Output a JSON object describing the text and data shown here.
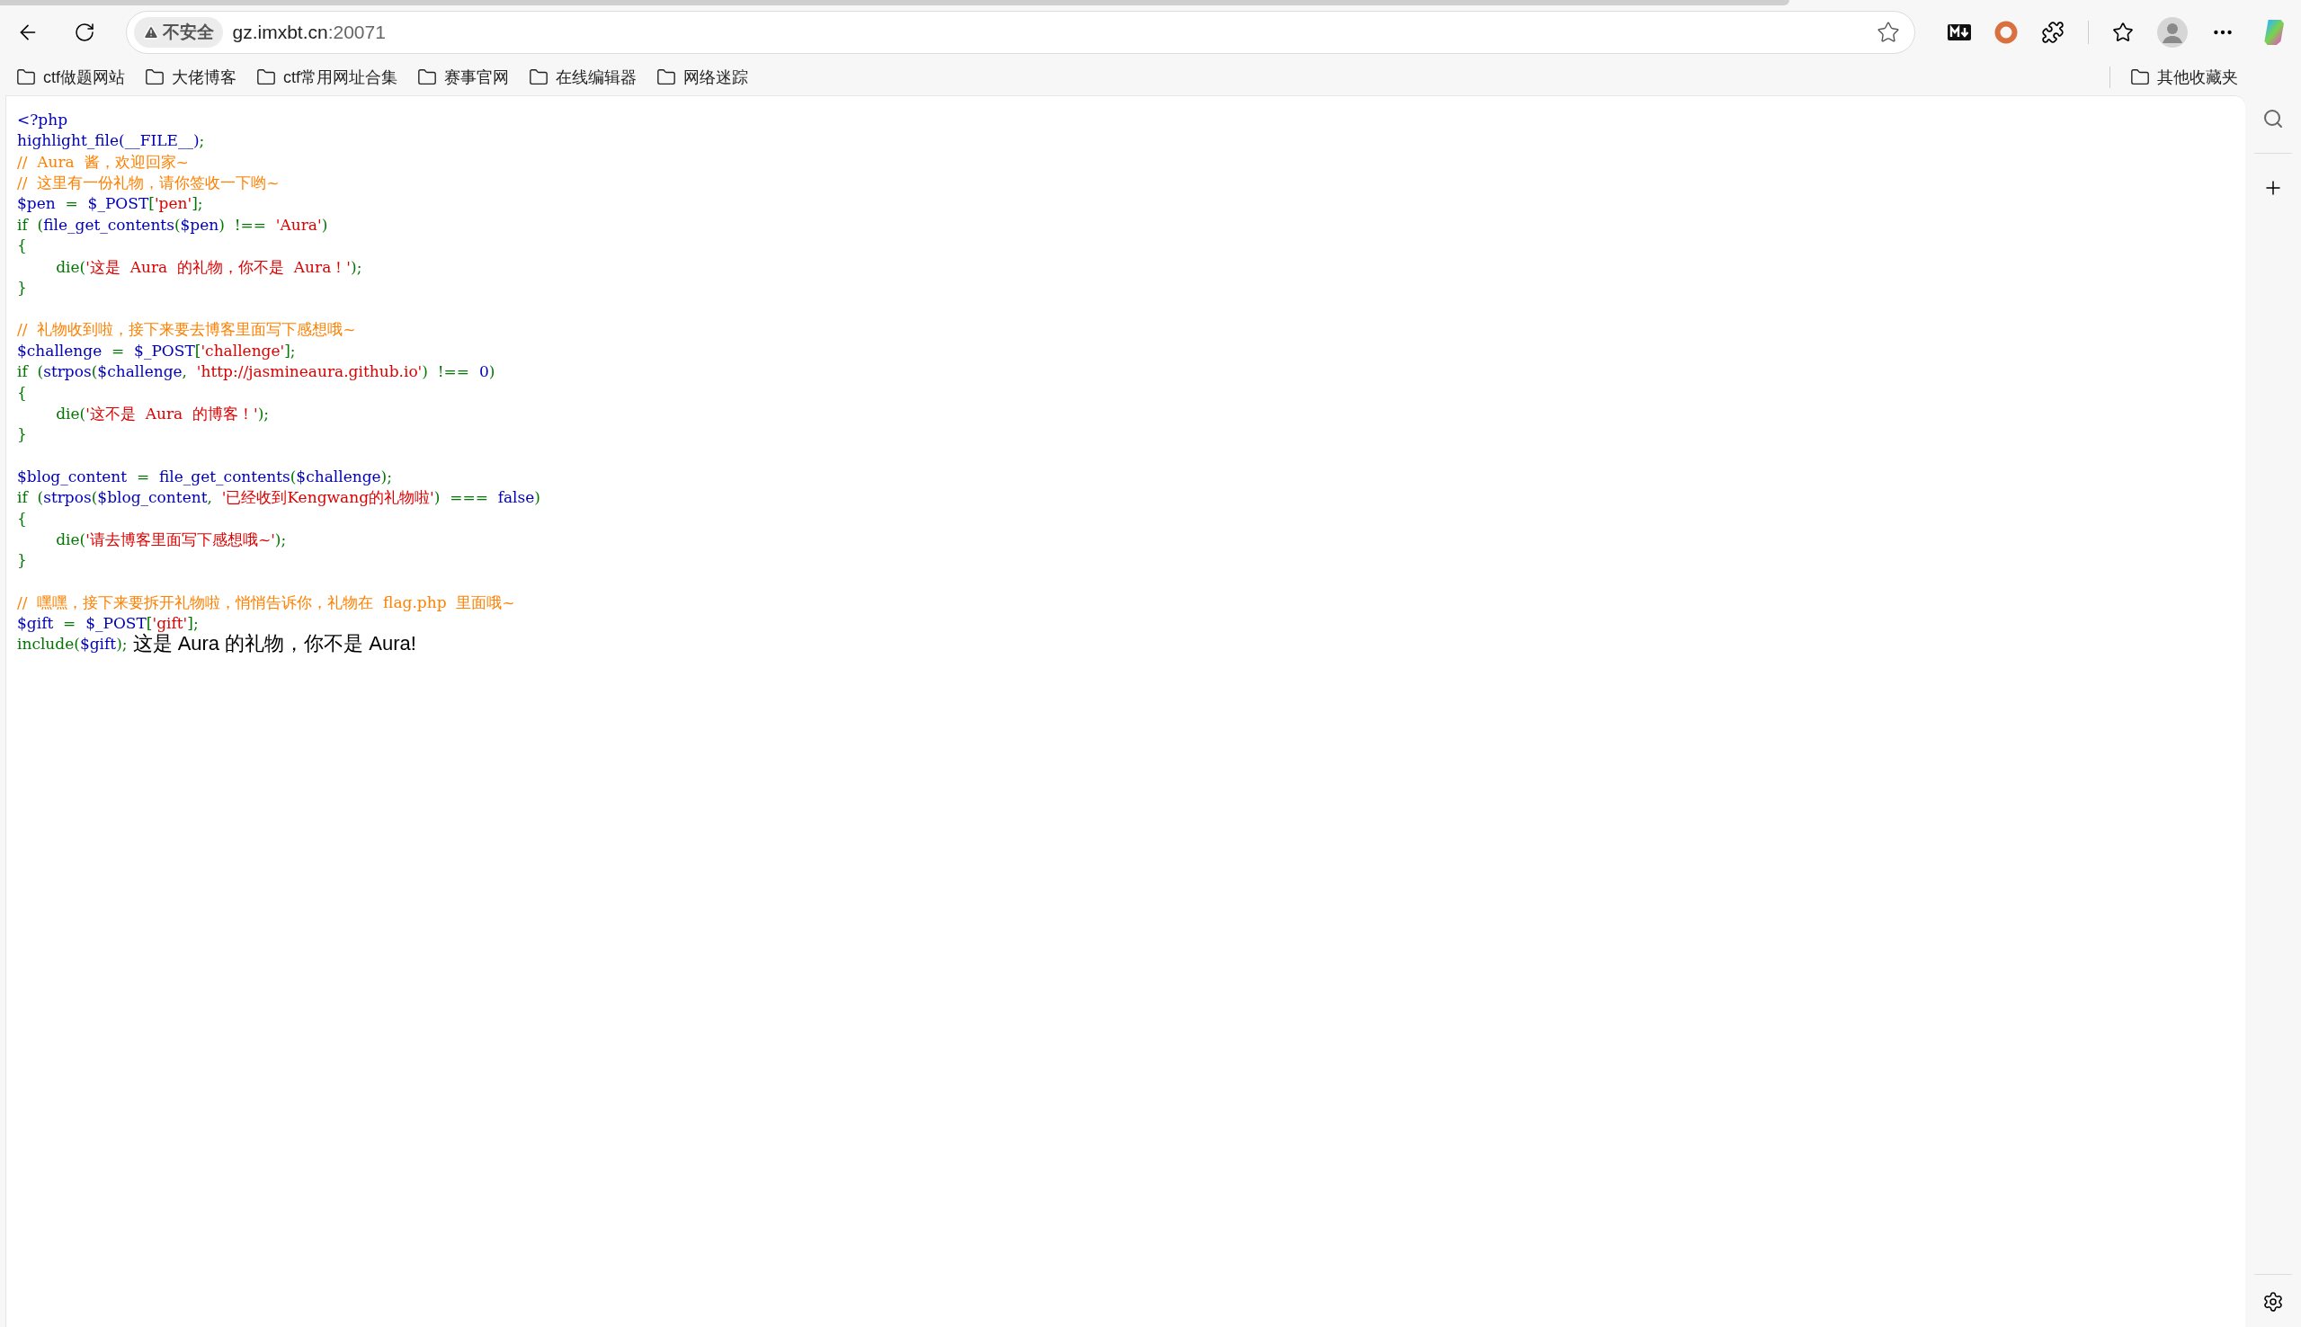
{
  "address_bar": {
    "security_label": "不安全",
    "host": "gz.imxbt.cn",
    "port": ":20071"
  },
  "bookmarks": [
    "ctf做题网站",
    "大佬博客",
    "ctf常用网址合集",
    "赛事官网",
    "在线编辑器",
    "网络迷踪"
  ],
  "other_bookmarks": "其他收藏夹",
  "code_blocks": [
    [
      [
        {
          "kind": "default",
          "text": "<?php"
        }
      ],
      [
        {
          "kind": "default",
          "text": "highlight_file(__FILE__)"
        },
        {
          "kind": "keyword",
          "text": ";"
        }
      ],
      [
        {
          "kind": "comment",
          "text": "//  Aura  酱，欢迎回家~"
        }
      ],
      [
        {
          "kind": "comment",
          "text": "//  这里有一份礼物，请你签收一下哟~"
        }
      ],
      [
        {
          "kind": "default",
          "text": "$pen"
        },
        {
          "kind": "keyword",
          "text": "  =  "
        },
        {
          "kind": "default",
          "text": "$_POST"
        },
        {
          "kind": "keyword",
          "text": "["
        },
        {
          "kind": "string",
          "text": "'pen'"
        },
        {
          "kind": "keyword",
          "text": "];"
        }
      ],
      [
        {
          "kind": "keyword",
          "text": "if  ("
        },
        {
          "kind": "default",
          "text": "file_get_contents"
        },
        {
          "kind": "keyword",
          "text": "("
        },
        {
          "kind": "default",
          "text": "$pen"
        },
        {
          "kind": "keyword",
          "text": ")  !==  "
        },
        {
          "kind": "string",
          "text": "'Aura'"
        },
        {
          "kind": "keyword",
          "text": ")"
        }
      ],
      [
        {
          "kind": "keyword",
          "text": "{"
        }
      ],
      [
        {
          "kind": "keyword",
          "text": "        die("
        },
        {
          "kind": "string",
          "text": "'这是  Aura  的礼物，你不是  Aura！'"
        },
        {
          "kind": "keyword",
          "text": ");"
        }
      ],
      [
        {
          "kind": "keyword",
          "text": "}"
        }
      ]
    ],
    [
      [
        {
          "kind": "comment",
          "text": "//  礼物收到啦，接下来要去博客里面写下感想哦~"
        }
      ],
      [
        {
          "kind": "default",
          "text": "$challenge"
        },
        {
          "kind": "keyword",
          "text": "  =  "
        },
        {
          "kind": "default",
          "text": "$_POST"
        },
        {
          "kind": "keyword",
          "text": "["
        },
        {
          "kind": "string",
          "text": "'challenge'"
        },
        {
          "kind": "keyword",
          "text": "];"
        }
      ],
      [
        {
          "kind": "keyword",
          "text": "if  ("
        },
        {
          "kind": "default",
          "text": "strpos"
        },
        {
          "kind": "keyword",
          "text": "("
        },
        {
          "kind": "default",
          "text": "$challenge"
        },
        {
          "kind": "keyword",
          "text": ",  "
        },
        {
          "kind": "string",
          "text": "'http://jasmineaura.github.io'"
        },
        {
          "kind": "keyword",
          "text": ")  !==  "
        },
        {
          "kind": "default",
          "text": "0"
        },
        {
          "kind": "keyword",
          "text": ")"
        }
      ],
      [
        {
          "kind": "keyword",
          "text": "{"
        }
      ],
      [
        {
          "kind": "keyword",
          "text": "        die("
        },
        {
          "kind": "string",
          "text": "'这不是  Aura  的博客！'"
        },
        {
          "kind": "keyword",
          "text": ");"
        }
      ],
      [
        {
          "kind": "keyword",
          "text": "}"
        }
      ]
    ],
    [
      [
        {
          "kind": "default",
          "text": "$blog_content"
        },
        {
          "kind": "keyword",
          "text": "  =  "
        },
        {
          "kind": "default",
          "text": "file_get_contents"
        },
        {
          "kind": "keyword",
          "text": "("
        },
        {
          "kind": "default",
          "text": "$challenge"
        },
        {
          "kind": "keyword",
          "text": ");"
        }
      ],
      [
        {
          "kind": "keyword",
          "text": "if  ("
        },
        {
          "kind": "default",
          "text": "strpos"
        },
        {
          "kind": "keyword",
          "text": "("
        },
        {
          "kind": "default",
          "text": "$blog_content"
        },
        {
          "kind": "keyword",
          "text": ",  "
        },
        {
          "kind": "string",
          "text": "'已经收到Kengwang的礼物啦'"
        },
        {
          "kind": "keyword",
          "text": ")  ===  "
        },
        {
          "kind": "default",
          "text": "false"
        },
        {
          "kind": "keyword",
          "text": ")"
        }
      ],
      [
        {
          "kind": "keyword",
          "text": "{"
        }
      ],
      [
        {
          "kind": "keyword",
          "text": "        die("
        },
        {
          "kind": "string",
          "text": "'请去博客里面写下感想哦~'"
        },
        {
          "kind": "keyword",
          "text": ");"
        }
      ],
      [
        {
          "kind": "keyword",
          "text": "}"
        }
      ]
    ],
    [
      [
        {
          "kind": "comment",
          "text": "//  嘿嘿，接下来要拆开礼物啦，悄悄告诉你，礼物在  flag.php  里面哦~"
        }
      ],
      [
        {
          "kind": "default",
          "text": "$gift"
        },
        {
          "kind": "keyword",
          "text": "  =  "
        },
        {
          "kind": "default",
          "text": "$_POST"
        },
        {
          "kind": "keyword",
          "text": "["
        },
        {
          "kind": "string",
          "text": "'gift'"
        },
        {
          "kind": "keyword",
          "text": "];"
        }
      ],
      [
        {
          "kind": "keyword",
          "text": "include("
        },
        {
          "kind": "default",
          "text": "$gift"
        },
        {
          "kind": "keyword",
          "text": ");"
        }
      ]
    ]
  ],
  "output": "这是 Aura 的礼物，你不是 Aura!"
}
